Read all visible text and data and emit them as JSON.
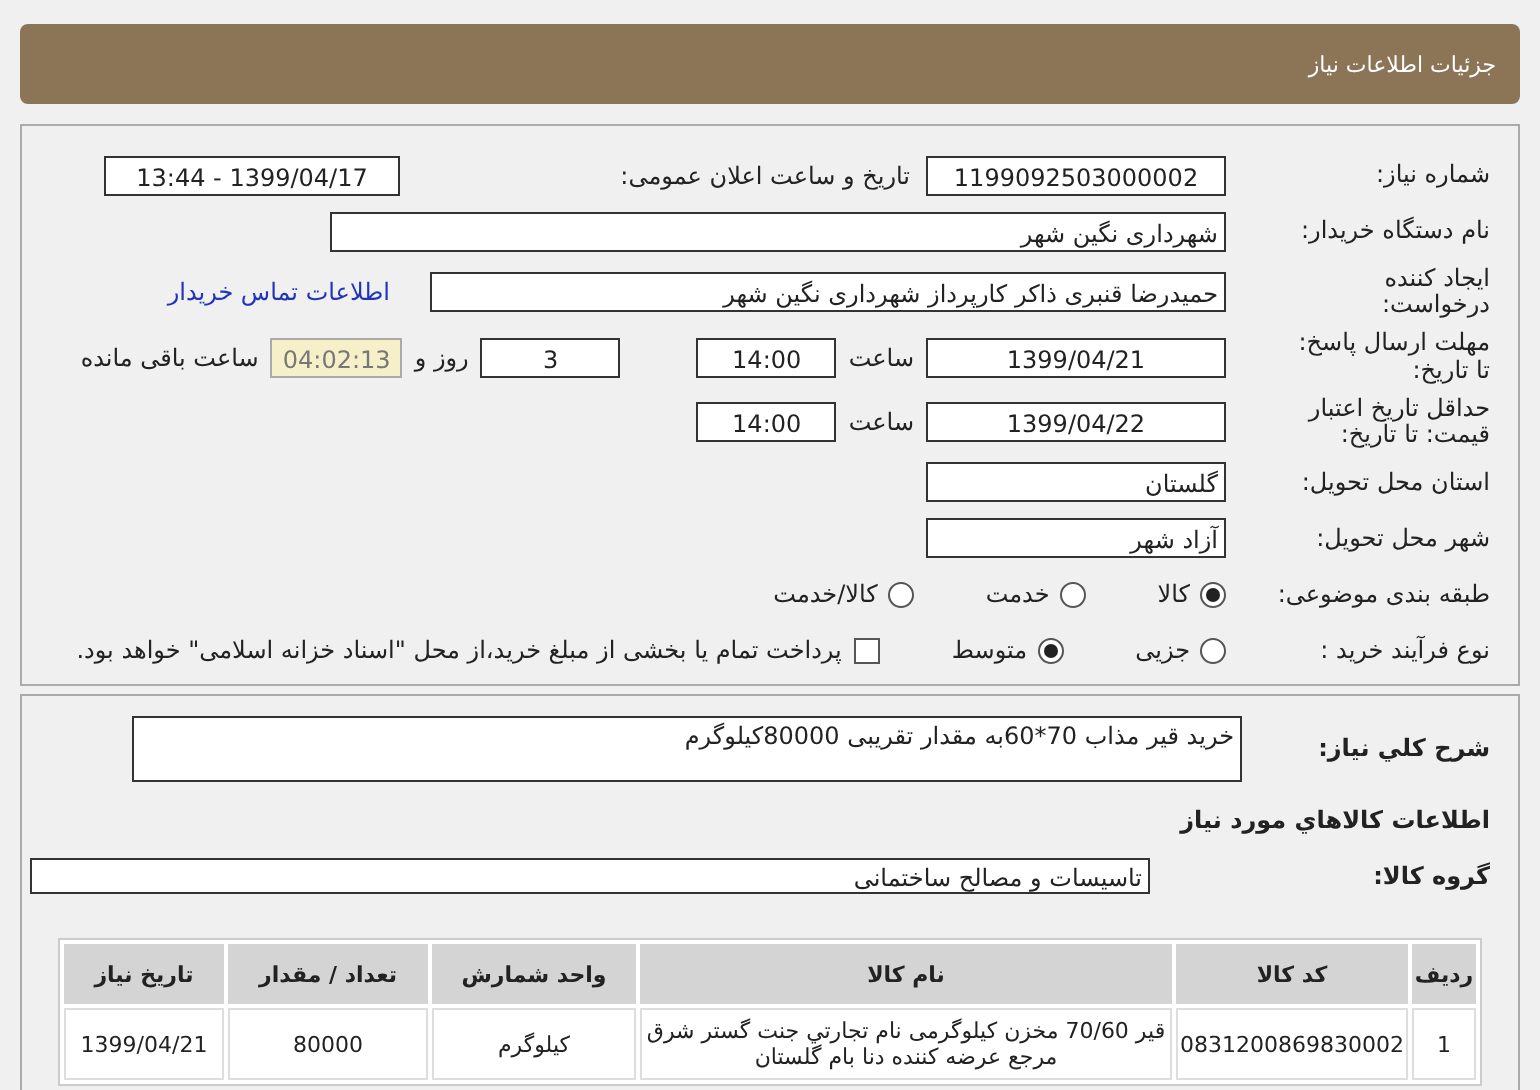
{
  "header": {
    "title": "جزئیات اطلاعات نیاز"
  },
  "need_number": {
    "label": "شماره نیاز:",
    "value": "1199092503000002"
  },
  "announce": {
    "label": "تاریخ و ساعت اعلان عمومی:",
    "value": "1399/04/17 - 13:44"
  },
  "buyer": {
    "label": "نام دستگاه خریدار:",
    "value": "شهرداری نگین شهر"
  },
  "creator": {
    "label": "ایجاد کننده\nدرخواست:",
    "value": "حمیدرضا قنبری ذاکر کارپرداز شهرداری نگین شهر",
    "link": "اطلاعات تماس خریدار"
  },
  "reply_deadline": {
    "label": "مهلت ارسال پاسخ:\nتا تاریخ:",
    "date": "1399/04/21",
    "time_label": "ساعت",
    "time": "14:00",
    "days": "3",
    "days_label": "روز و",
    "remaining": "04:02:13",
    "remaining_label": "ساعت باقی مانده"
  },
  "price_validity": {
    "label": "حداقل تاریخ اعتبار\nقیمت: تا تاریخ:",
    "date": "1399/04/22",
    "time_label": "ساعت",
    "time": "14:00"
  },
  "province": {
    "label": "استان محل تحویل:",
    "value": "گلستان"
  },
  "city": {
    "label": "شهر محل تحویل:",
    "value": "آزاد شهر"
  },
  "category": {
    "label": "طبقه بندی موضوعی:",
    "options": [
      {
        "label": "کالا",
        "selected": true
      },
      {
        "label": "خدمت",
        "selected": false
      },
      {
        "label": "کالا/خدمت",
        "selected": false
      }
    ]
  },
  "process": {
    "label": "نوع فرآیند خرید :",
    "options": [
      {
        "label": "جزیی",
        "selected": false
      },
      {
        "label": "متوسط",
        "selected": true
      }
    ],
    "payment_note": {
      "checked": false,
      "text": "پرداخت تمام یا بخشی از مبلغ خرید،از محل \"اسناد خزانه اسلامی\" خواهد بود."
    }
  },
  "description": {
    "label": "شرح کلي نياز:",
    "value": "خرید قیر مذاب 70*60به مقدار تقریبی 80000کیلوگرم"
  },
  "goods_title": "اطلاعات کالاهاي مورد نياز",
  "goods_group": {
    "label": "گروه کالا:",
    "value": "تاسیسات و مصالح ساختمانی"
  },
  "table": {
    "columns": [
      "ردیف",
      "کد کالا",
      "نام کالا",
      "واحد شمارش",
      "تعداد / مقدار",
      "تاریخ نیاز"
    ],
    "rows": [
      [
        "1",
        "0831200869830002",
        "قیر 70/60 مخزن کیلوگرمی نام تجارتي جنت گستر شرق مرجع عرضه کننده دنا بام گلستان",
        "کیلوگرم",
        "80000",
        "1399/04/21"
      ]
    ]
  }
}
